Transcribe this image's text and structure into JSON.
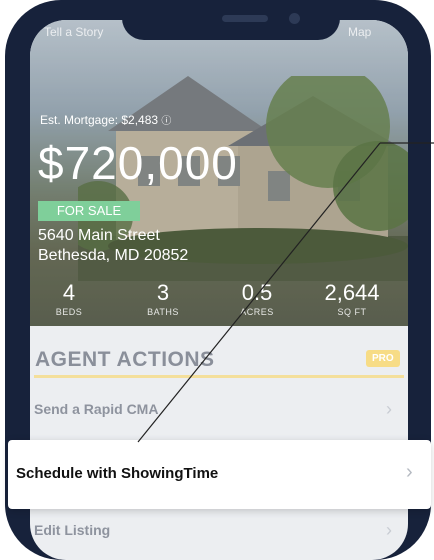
{
  "hero": {
    "top_left": "Tell a Story",
    "top_right": "Map",
    "est_mortgage": "Est. Mortgage: $2,483",
    "price": "$720,000",
    "badge": "FOR SALE",
    "address_line1": "5640 Main Street",
    "address_line2": "Bethesda, MD 20852",
    "stats": [
      {
        "value": "4",
        "label": "BEDS"
      },
      {
        "value": "3",
        "label": "BATHS"
      },
      {
        "value": "0.5",
        "label": "ACRES"
      },
      {
        "value": "2,644",
        "label": "SQ FT"
      }
    ]
  },
  "agent_actions": {
    "title": "AGENT ACTIONS",
    "pro_badge": "PRO",
    "items": [
      {
        "label": "Send a Rapid CMA"
      },
      {
        "label": "Schedule with ShowingTime"
      },
      {
        "label": "Edit Listing"
      }
    ]
  },
  "colors": {
    "frame": "#17223b",
    "badge_green": "#7fcf9a",
    "pro_yellow": "#f7dc86"
  }
}
